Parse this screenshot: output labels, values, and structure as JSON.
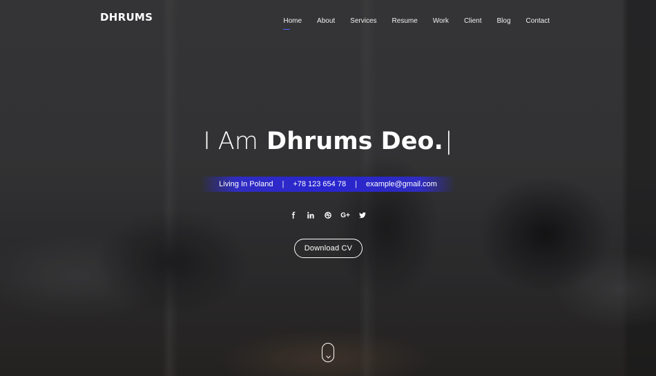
{
  "brand": {
    "logo": "DHRUMS"
  },
  "nav": {
    "items": [
      {
        "label": "Home",
        "active": true
      },
      {
        "label": "About"
      },
      {
        "label": "Services"
      },
      {
        "label": "Resume"
      },
      {
        "label": "Work"
      },
      {
        "label": "Client"
      },
      {
        "label": "Blog"
      },
      {
        "label": "Contact"
      }
    ]
  },
  "hero": {
    "greeting": "I Am",
    "name": "Dhrums Deo.",
    "cursor": "|",
    "location": "Living In Poland",
    "separator": "|",
    "phone": "+78 123 654 78",
    "email": "example@gmail.com",
    "download_label": "Download CV"
  },
  "social": [
    "facebook-icon",
    "linkedin-icon",
    "dribbble-icon",
    "google-plus-icon",
    "twitter-icon"
  ],
  "social_labels": {
    "google_plus": "G+"
  },
  "colors": {
    "accent": "#3b37e0",
    "nav_underline": "#4a63ff",
    "text": "#ffffff"
  }
}
